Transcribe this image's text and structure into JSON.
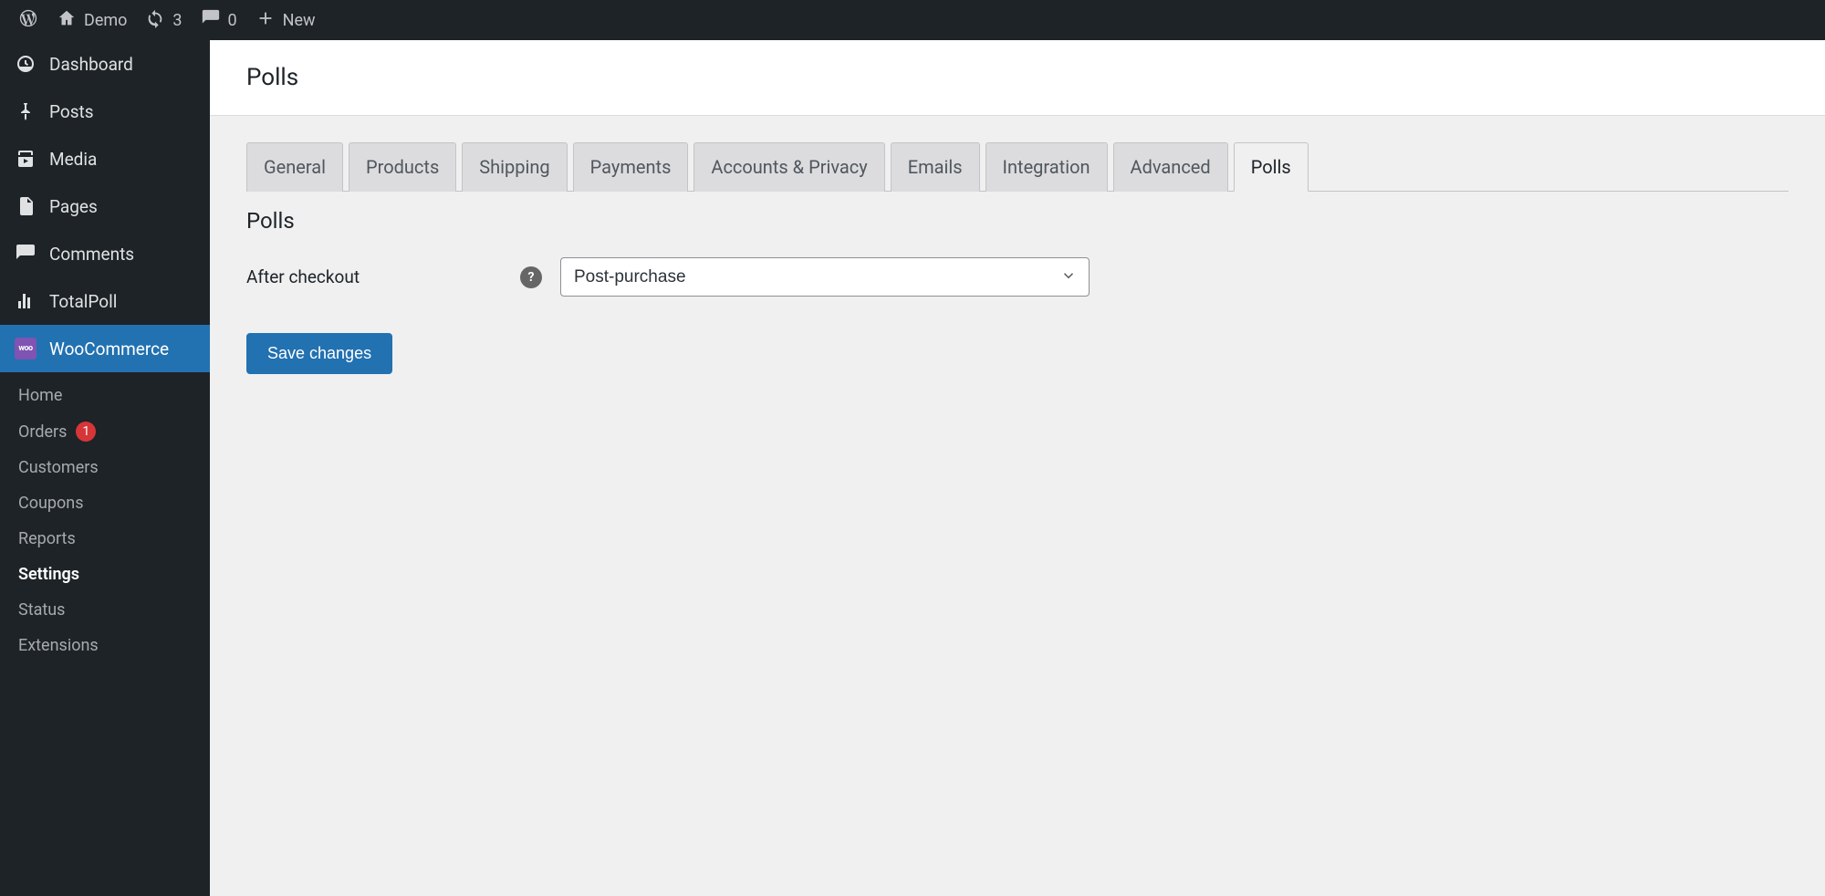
{
  "adminbar": {
    "site_name": "Demo",
    "updates_count": "3",
    "comments_count": "0",
    "new_label": "New"
  },
  "sidemenu": {
    "dashboard": "Dashboard",
    "posts": "Posts",
    "media": "Media",
    "pages": "Pages",
    "comments": "Comments",
    "totalpoll": "TotalPoll",
    "woocommerce": "WooCommerce"
  },
  "woosubmenu": {
    "home": "Home",
    "orders": "Orders",
    "orders_badge": "1",
    "customers": "Customers",
    "coupons": "Coupons",
    "reports": "Reports",
    "settings": "Settings",
    "status": "Status",
    "extensions": "Extensions"
  },
  "page": {
    "title": "Polls",
    "section_heading": "Polls"
  },
  "tabs": {
    "general": "General",
    "products": "Products",
    "shipping": "Shipping",
    "payments": "Payments",
    "accounts_privacy": "Accounts & Privacy",
    "emails": "Emails",
    "integration": "Integration",
    "advanced": "Advanced",
    "polls": "Polls"
  },
  "form": {
    "after_checkout_label": "After checkout",
    "after_checkout_value": "Post-purchase",
    "save_button": "Save changes"
  }
}
